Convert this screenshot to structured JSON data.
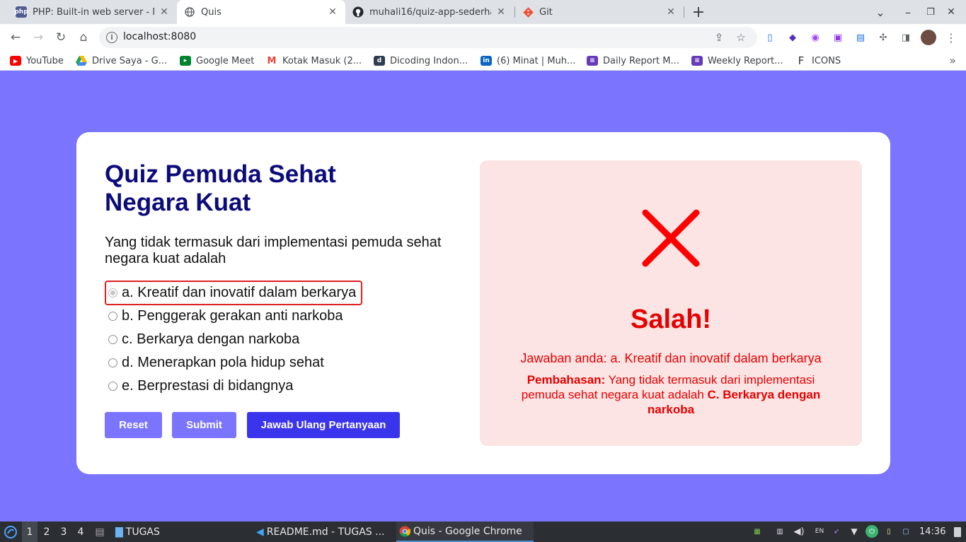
{
  "browser": {
    "tabs": [
      {
        "title": "PHP: Built-in web server - M",
        "icon": "php-icon",
        "active": false
      },
      {
        "title": "Quis",
        "icon": "globe-icon",
        "active": true
      },
      {
        "title": "muhali16/quiz-app-sederha",
        "icon": "github-icon",
        "active": false
      },
      {
        "title": "Git",
        "icon": "git-icon",
        "active": false
      }
    ],
    "new_tab": "+",
    "url": "localhost:8080"
  },
  "bookmarks": [
    {
      "label": "YouTube",
      "icon": "youtube-icon",
      "color": "#ff0000"
    },
    {
      "label": "Drive Saya - G...",
      "icon": "google-drive-icon",
      "color": "#1fa463"
    },
    {
      "label": "Google Meet",
      "icon": "google-meet-icon",
      "color": "#00832d"
    },
    {
      "label": "Kotak Masuk (2...",
      "icon": "gmail-icon",
      "color": "#ea4335"
    },
    {
      "label": "Dicoding Indon...",
      "icon": "dicoding-icon",
      "color": "#2d3e50"
    },
    {
      "label": "(6) Minat | Muh...",
      "icon": "linkedin-icon",
      "color": "#0a66c2"
    },
    {
      "label": "Daily Report M...",
      "icon": "forms-icon",
      "color": "#673ab7"
    },
    {
      "label": "Weekly Report...",
      "icon": "forms-icon",
      "color": "#673ab7"
    },
    {
      "label": "ICONS",
      "icon": "f-icon",
      "color": "#333333"
    }
  ],
  "quiz": {
    "title": "Quiz Pemuda Sehat Negara Kuat",
    "question": "Yang tidak termasuk dari implementasi pemuda sehat negara kuat adalah",
    "options": [
      "a. Kreatif dan inovatif dalam berkarya",
      "b. Penggerak gerakan anti narkoba",
      "c. Berkarya dengan narkoba",
      "d. Menerapkan pola hidup sehat",
      "e. Berprestasi di bidangnya"
    ],
    "selected_index": 0,
    "buttons": {
      "reset": "Reset",
      "submit": "Submit",
      "retry": "Jawab Ulang Pertanyaan"
    }
  },
  "result": {
    "status": "Salah!",
    "answer_text": "Jawaban anda: a. Kreatif dan inovatif dalam berkarya",
    "explanation_label": "Pembahasan:",
    "explanation_text": " Yang tidak termasuk dari implementasi pemuda sehat negara kuat adalah ",
    "correct_answer": "C. Berkarya dengan narkoba",
    "color": "#e60000"
  },
  "taskbar": {
    "workspaces": [
      "1",
      "2",
      "3",
      "4"
    ],
    "folder": "TUGAS",
    "windows": [
      {
        "label": "README.md - TUGAS ...",
        "icon": "vscode-icon"
      },
      {
        "label": "Quis - Google Chrome",
        "icon": "chrome-icon"
      }
    ],
    "tray_lang": "EN",
    "clock": "14:36"
  },
  "colors": {
    "page_bg": "#7b74ff",
    "title": "#0b0b7a",
    "primary_button": "#3a34ec",
    "error": "#e60000"
  }
}
